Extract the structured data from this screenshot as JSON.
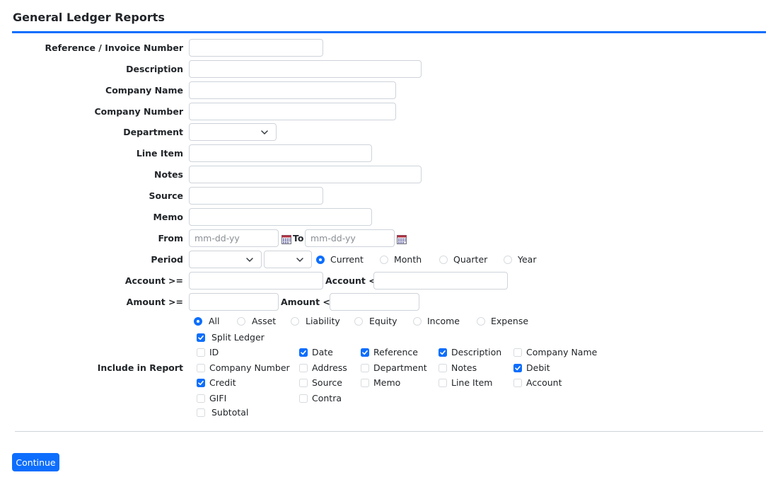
{
  "page": {
    "title": "General Ledger Reports"
  },
  "fields": {
    "reference": {
      "label": "Reference / Invoice Number",
      "value": ""
    },
    "description": {
      "label": "Description",
      "value": ""
    },
    "company_name": {
      "label": "Company Name",
      "value": ""
    },
    "company_number": {
      "label": "Company Number",
      "value": ""
    },
    "department": {
      "label": "Department",
      "value": ""
    },
    "line_item": {
      "label": "Line Item",
      "value": ""
    },
    "notes": {
      "label": "Notes",
      "value": ""
    },
    "source": {
      "label": "Source",
      "value": ""
    },
    "memo": {
      "label": "Memo",
      "value": ""
    }
  },
  "dates": {
    "from_label": "From",
    "to_label": "To",
    "from_placeholder": "mm-dd-yy",
    "to_placeholder": "mm-dd-yy"
  },
  "period": {
    "label": "Period",
    "options": [
      "Current",
      "Month",
      "Quarter",
      "Year"
    ],
    "selected": "Current"
  },
  "account": {
    "from_label": "Account >=",
    "to_label": "Account <="
  },
  "amount": {
    "from_label": "Amount >=",
    "to_label": "Amount <="
  },
  "account_types": {
    "options": [
      "All",
      "Asset",
      "Liability",
      "Equity",
      "Income",
      "Expense"
    ],
    "selected": "All"
  },
  "include": {
    "label": "Include in Report",
    "split_ledger": {
      "label": "Split Ledger",
      "checked": true
    },
    "columns": [
      {
        "label": "ID",
        "checked": false
      },
      {
        "label": "Date",
        "checked": true
      },
      {
        "label": "Reference",
        "checked": true
      },
      {
        "label": "Description",
        "checked": true
      },
      {
        "label": "Company Name",
        "checked": false
      },
      {
        "label": "Company Number",
        "checked": false
      },
      {
        "label": "Address",
        "checked": false
      },
      {
        "label": "Department",
        "checked": false
      },
      {
        "label": "Notes",
        "checked": false
      },
      {
        "label": "Debit",
        "checked": true
      },
      {
        "label": "Credit",
        "checked": true
      },
      {
        "label": "Source",
        "checked": false
      },
      {
        "label": "Memo",
        "checked": false
      },
      {
        "label": "Line Item",
        "checked": false
      },
      {
        "label": "Account",
        "checked": false
      },
      {
        "label": "GIFI",
        "checked": false
      },
      {
        "label": "Contra",
        "checked": false
      }
    ],
    "subtotal": {
      "label": "Subtotal",
      "checked": false
    }
  },
  "actions": {
    "continue_label": "Continue"
  },
  "colors": {
    "accent": "#0d6efd"
  }
}
